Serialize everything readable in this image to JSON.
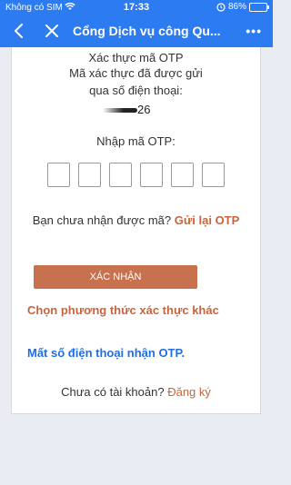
{
  "status_bar": {
    "carrier": "Không có SIM",
    "time": "17:33",
    "battery": "86%",
    "battery_level": 0.86,
    "icons": [
      "wifi-icon",
      "alarm-icon",
      "battery-icon"
    ]
  },
  "nav": {
    "title": "Cổng Dịch vụ công Qu...",
    "back_icon": "chevron-left-icon",
    "close_icon": "close-icon",
    "more": "•••"
  },
  "content": {
    "heading": "Xác thực mã OTP",
    "sent_line1": "Mã xác thực đã được gửi",
    "sent_line2": "qua số điện thoại:",
    "phone_suffix": "26",
    "otp_label": "Nhập mã OTP:",
    "otp_boxes": [
      "",
      "",
      "",
      "",
      "",
      ""
    ],
    "not_received": "Bạn chưa nhận được mã?",
    "resend": "Gửi lại OTP",
    "confirm": "XÁC NHẬN",
    "alt_method": "Chọn phương thức xác thực khác",
    "lost_phone": "Mất số điện thoại nhận OTP.",
    "no_account": "Chưa có tài khoản?",
    "signup": "Đăng ký"
  },
  "colors": {
    "header_blue": "#2d7bf0",
    "accent_orange": "#c8643c",
    "button_orange": "#c7714e",
    "link_blue": "#1f6fe2"
  }
}
